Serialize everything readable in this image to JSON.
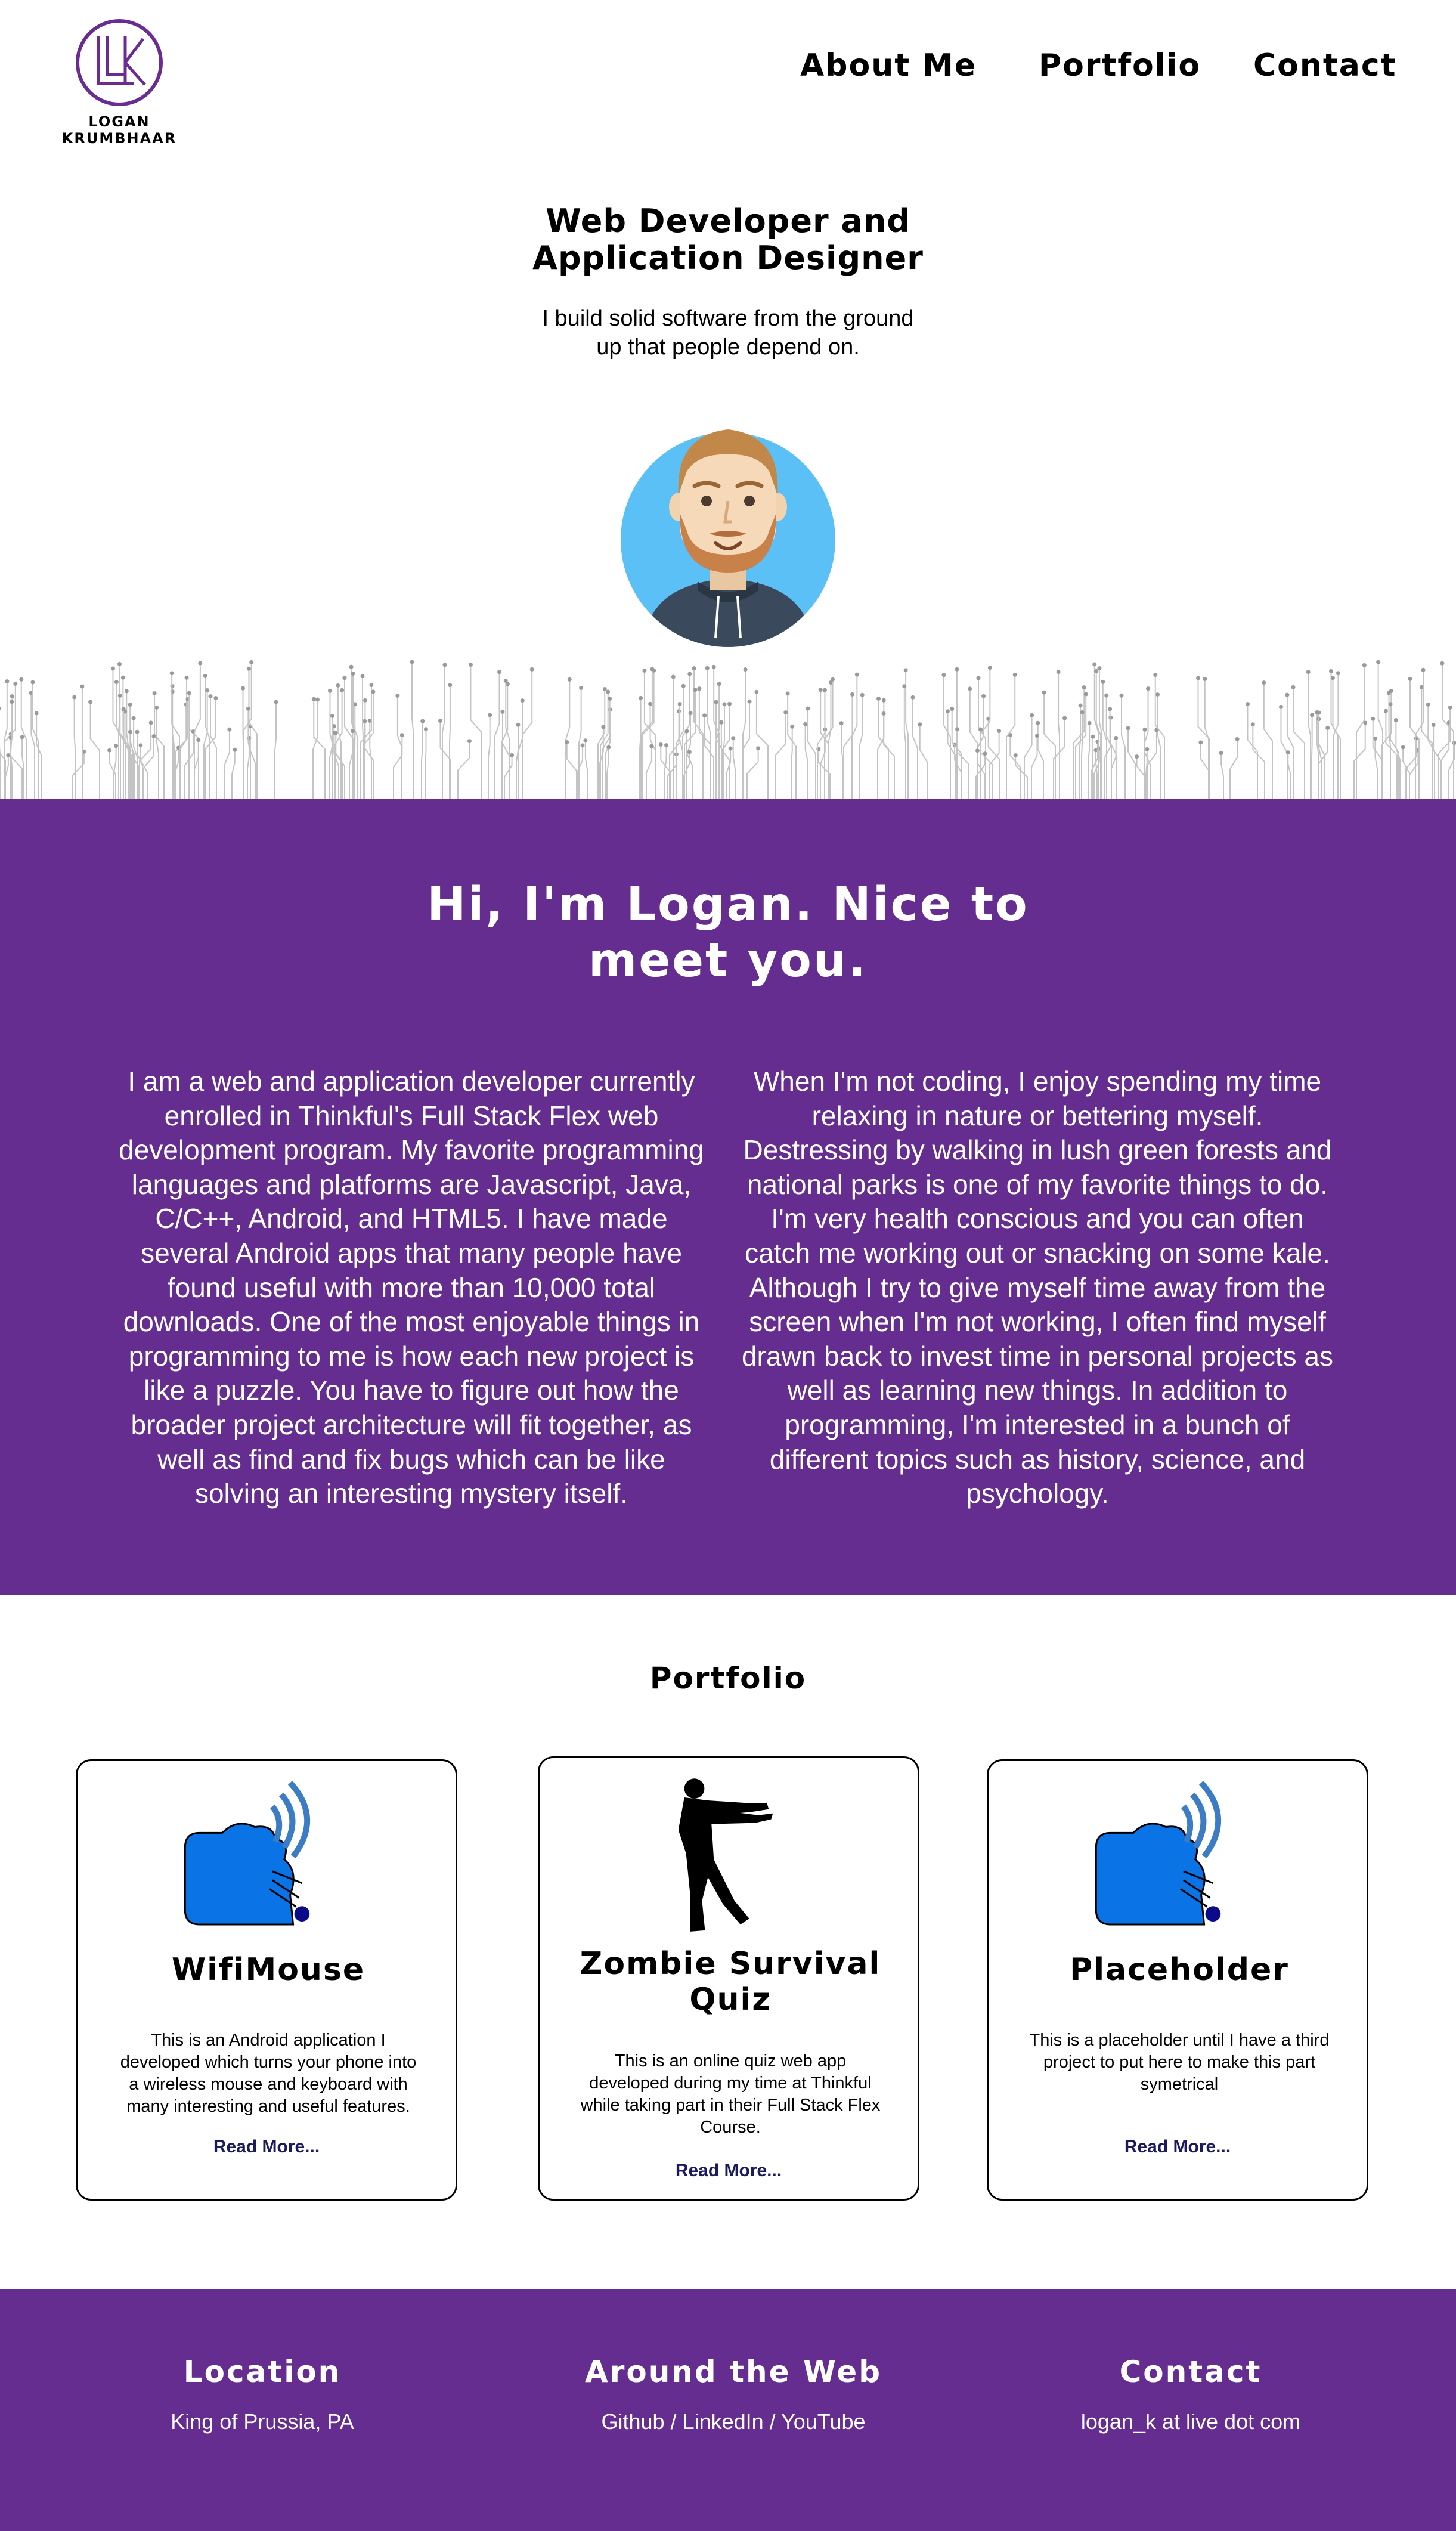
{
  "header": {
    "logo_text": "LOGAN KRUMBHAAR",
    "nav": [
      {
        "label": "About Me"
      },
      {
        "label": "Portfolio"
      },
      {
        "label": "Contact"
      }
    ]
  },
  "hero": {
    "title_line1": "Web Developer and",
    "title_line2": "Application Designer",
    "subtitle_line1": "I build solid software from the ground",
    "subtitle_line2": "up that people depend on."
  },
  "about": {
    "title_line1": "Hi, I'm Logan. Nice to",
    "title_line2": "meet you.",
    "left_paragraph": "I am a web and application developer currently enrolled in Thinkful's Full Stack Flex web development program. My favorite programming languages and platforms are Javascript, Java, C/C++, Android, and HTML5. I have made several Android apps that many people have found useful with more than 10,000 total downloads. One of the most enjoyable things in programming to me is how each new project is like a puzzle. You have to figure out how the broader project architecture will fit together, as well as find and fix bugs which can be like solving an interesting mystery itself.",
    "right_paragraph": "When I'm not coding, I enjoy spending my time relaxing in nature or bettering myself. Destressing by walking in lush green forests and national parks is one of my favorite things to do. I'm very health conscious and you can often catch me working out or snacking on some kale. Although I try to give myself time away from the screen when I'm not working, I often find myself drawn back to invest time in personal projects as well as learning new things. In addition to programming, I'm interested in a bunch of different topics such as history, science, and psychology."
  },
  "portfolio": {
    "title": "Portfolio",
    "cards": [
      {
        "title": "WifiMouse",
        "description": "This is an Android application I developed which turns your phone into a wireless mouse and keyboard with many interesting and useful features.",
        "link": "Read More...",
        "icon": "wifi-mouse-icon"
      },
      {
        "title": "Zombie Survival Quiz",
        "description": "This is an online quiz web app developed during my time at Thinkful while taking part in their Full Stack Flex Course.",
        "link": "Read More...",
        "icon": "zombie-icon"
      },
      {
        "title": "Placeholder",
        "description": "This is a placeholder until I have a third project to put here to make this part symetrical",
        "link": "Read More...",
        "icon": "wifi-mouse-icon"
      }
    ]
  },
  "footer": {
    "location_title": "Location",
    "location_text": "King of Prussia, PA",
    "web_title": "Around the Web",
    "web_links": [
      "Github",
      "LinkedIn",
      "YouTube"
    ],
    "web_separator": " / ",
    "contact_title": "Contact",
    "contact_text": "logan_k at live dot com"
  },
  "colors": {
    "brand_purple": "#652d90",
    "link_navy": "#1a1a5e",
    "logo_purple": "#6a2c91",
    "icon_blue": "#0a73e6"
  }
}
